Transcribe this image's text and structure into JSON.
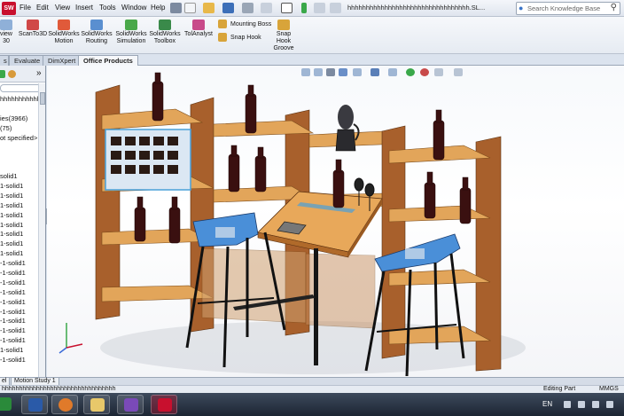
{
  "menubar": {
    "items": [
      "File",
      "Edit",
      "View",
      "Insert",
      "Tools",
      "Window",
      "Help"
    ],
    "document_title": "hhhhhhhhhhhhhhhhhhhhhhhhhhhhhhhhh.SL...",
    "search_placeholder": "Search Knowledge Base"
  },
  "ribbon": {
    "buttons": [
      {
        "label": "view",
        "label2": "30"
      },
      {
        "label": "ScanTo3D",
        "label2": ""
      },
      {
        "label": "SolidWorks",
        "label2": "Motion"
      },
      {
        "label": "SolidWorks",
        "label2": "Routing"
      },
      {
        "label": "SolidWorks",
        "label2": "Simulation"
      },
      {
        "label": "SolidWorks",
        "label2": "Toolbox"
      },
      {
        "label": "TolAnalyst",
        "label2": ""
      }
    ],
    "small_buttons": [
      "Mounting Boss",
      "Snap Hook"
    ],
    "snap_hook_groove": [
      "Snap",
      "Hook",
      "Groove"
    ]
  },
  "tabs": [
    "s",
    "Evaluate",
    "DimXpert",
    "Office Products"
  ],
  "active_tab": "Office Products",
  "feature_tree": {
    "rows": [
      "hhhhhhhhhhhhhhhhh",
      "",
      "ies(3966)",
      "(75)",
      "ot specified>",
      "",
      "",
      "",
      "solid1",
      "1-solid1",
      "1-solid1",
      "1-solid1",
      "1-solid1",
      "1-solid1",
      "1-solid1",
      "1-solid1",
      "1-solid1",
      "-1-solid1",
      "-1-solid1",
      "-1-solid1",
      "-1-solid1",
      "-1-solid1",
      "-1-solid1",
      "-1-solid1",
      "-1-solid1",
      "-1-solid1",
      "1-solid1",
      "-1-solid1"
    ]
  },
  "motion_tabs": [
    "el",
    "Motion Study 1"
  ],
  "status": {
    "document_name": "hhhhhhhhhhhhhhhhhhhhhhhhhhhhhhhhh",
    "mode": "Editing Part",
    "units": "MMGS"
  },
  "taskbar": {
    "apps": [
      "windows-explorer",
      "powershell",
      "firefox",
      "file-explorer",
      "visual-studio",
      "solidworks"
    ],
    "language": "EN"
  },
  "colors": {
    "wood": "#d99a4c",
    "wood_dark": "#9a5a2e",
    "stool_seat": "#4a8fd8",
    "steel": "#1a1a1a",
    "bottle": "#3a1010",
    "brand_red": "#c8102e"
  }
}
